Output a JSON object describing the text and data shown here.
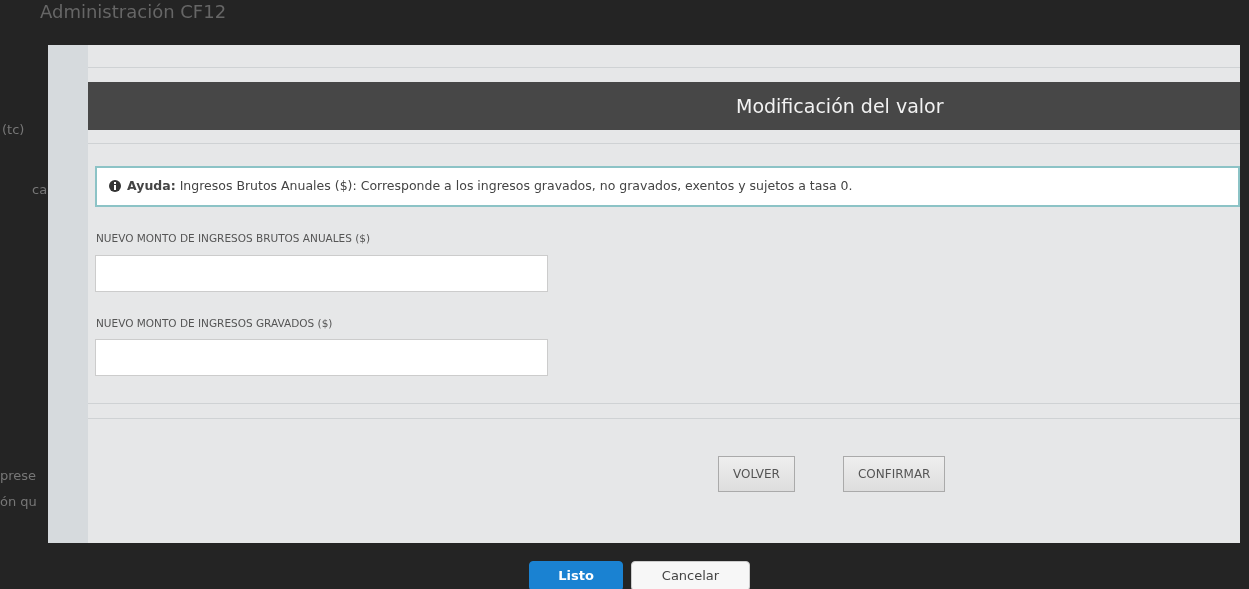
{
  "background": {
    "title": "Administración CF12",
    "texts": [
      "(tc)",
      "ca",
      "prese",
      "ón qu"
    ]
  },
  "dialog": {
    "title": "Modificación del valor",
    "help": {
      "label": "Ayuda:",
      "text": "Ingresos Brutos Anuales ($): Corresponde a los ingresos gravados, no gravados, exentos y sujetos a tasa 0."
    },
    "fields": [
      {
        "label": "NUEVO MONTO DE INGRESOS BRUTOS ANUALES ($)"
      },
      {
        "label": "NUEVO MONTO DE INGRESOS GRAVADOS ($)"
      }
    ],
    "buttons": [
      "VOLVER",
      "CONFIRMAR"
    ]
  },
  "footer_buttons": [
    {
      "label": "Listo",
      "kind": "primary"
    },
    {
      "label": "Cancelar",
      "kind": "secondary"
    }
  ]
}
